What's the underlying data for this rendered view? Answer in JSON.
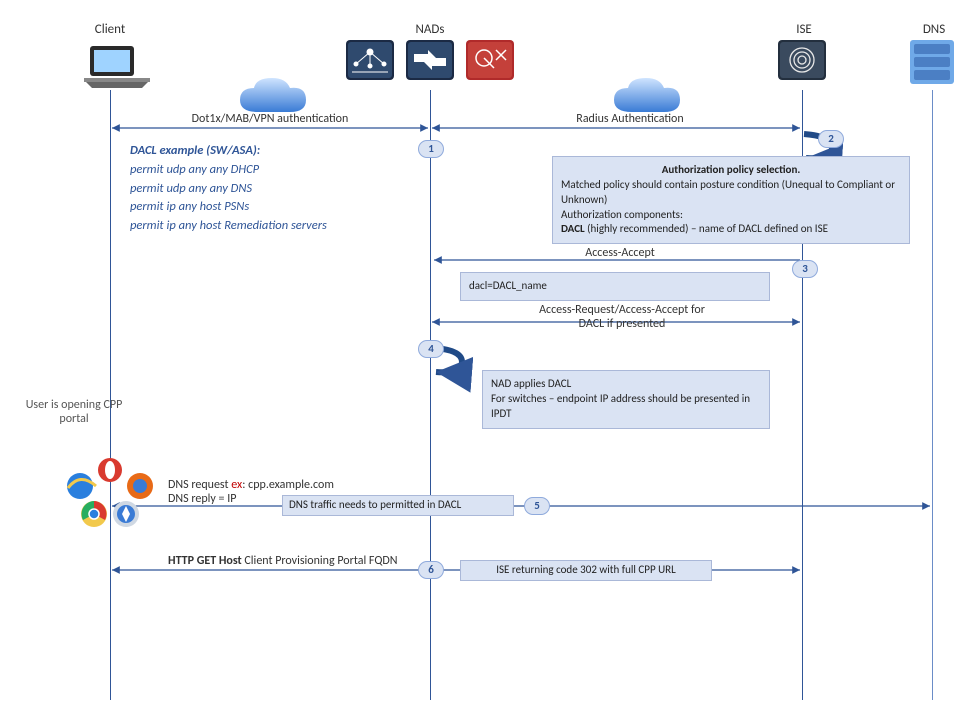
{
  "actors": {
    "client": "Client",
    "nads": "NADs",
    "ise": "ISE",
    "dns": "DNS"
  },
  "messages": {
    "auth_client_nad": "Dot1x/MAB/VPN  authentication",
    "auth_nad_ise": "Radius Authentication",
    "access_accept": "Access-Accept",
    "dacl_attr": "dacl=DACL_name",
    "access_req_dacl_l1": "Access-Request/Access-Accept for",
    "access_req_dacl_l2": "DACL if presented",
    "dns_req_pre": "DNS request ",
    "dns_req_ex_label": "ex",
    "dns_req_post": ": cpp.example.com",
    "dns_reply": "DNS reply = IP",
    "http_get_pre": "HTTP GET Host ",
    "http_get_post": "Client Provisioning Portal FQDN"
  },
  "boxes": {
    "auth_policy_title": "Authorization  policy selection.",
    "auth_policy_l1": "Matched policy should contain posture condition (Unequal to Compliant or Unknown)",
    "auth_policy_l2": "Authorization components:",
    "auth_policy_l3a": "DACL",
    "auth_policy_l3b": " (highly recommended) – name of DACL defined on ISE",
    "nad_applies_l1": "NAD applies DACL",
    "nad_applies_l2": "For switches – endpoint IP address should be presented in IPDT",
    "dns_traffic": "DNS traffic needs to permitted in DACL",
    "ise_302": "ISE returning code 302 with full CPP URL"
  },
  "dacl_example": {
    "title": "DACL example (SW/ASA):",
    "l1": "permit udp any any  DHCP",
    "l2": "permit udp any any DNS",
    "l3": "permit ip any host PSNs",
    "l4": "permit ip any host Remediation servers"
  },
  "side": {
    "cpp_l1": "User is opening CPP",
    "cpp_l2": "portal"
  },
  "steps": {
    "s1": "1",
    "s2": "2",
    "s3": "3",
    "s4": "4",
    "s5": "5",
    "s6": "6"
  }
}
